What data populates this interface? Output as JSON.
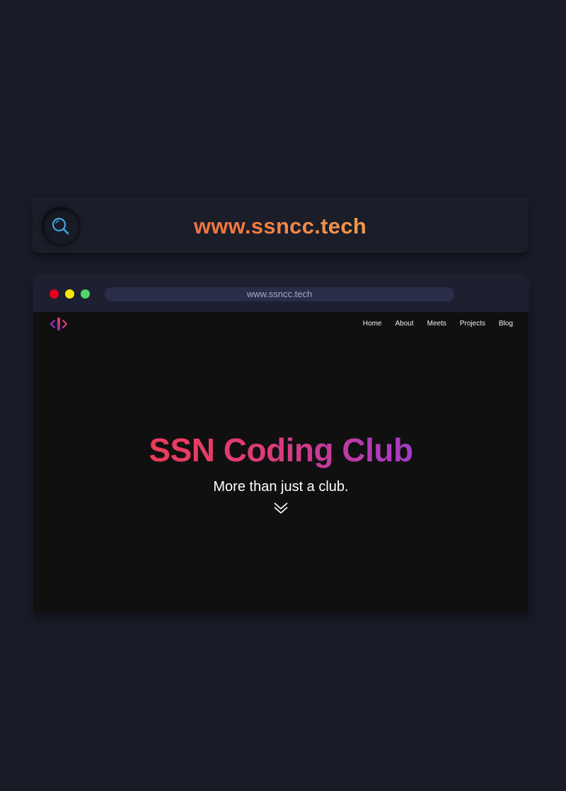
{
  "search_bar": {
    "icon": "search-icon",
    "url": "www.ssncc.tech",
    "colors": {
      "gradient_start": "#ec5a38",
      "gradient_end": "#f3c45f",
      "icon": "#3fa6e0"
    }
  },
  "browser": {
    "window_controls": [
      {
        "name": "close",
        "color": "#e8001f"
      },
      {
        "name": "minimize",
        "color": "#f7e50f"
      },
      {
        "name": "maximize",
        "color": "#4fd468"
      }
    ],
    "address": "www.ssncc.tech"
  },
  "site": {
    "logo": "ssncc-logo",
    "nav": [
      {
        "label": "Home"
      },
      {
        "label": "About"
      },
      {
        "label": "Meets"
      },
      {
        "label": "Projects"
      },
      {
        "label": "Blog"
      }
    ],
    "hero": {
      "title": "SSN Coding Club",
      "subtitle": "More than just a club.",
      "scroll_icon": "double-chevron-down-icon",
      "colors": {
        "gradient_start": "#ee3c58",
        "gradient_end": "#a43bc8"
      }
    }
  }
}
